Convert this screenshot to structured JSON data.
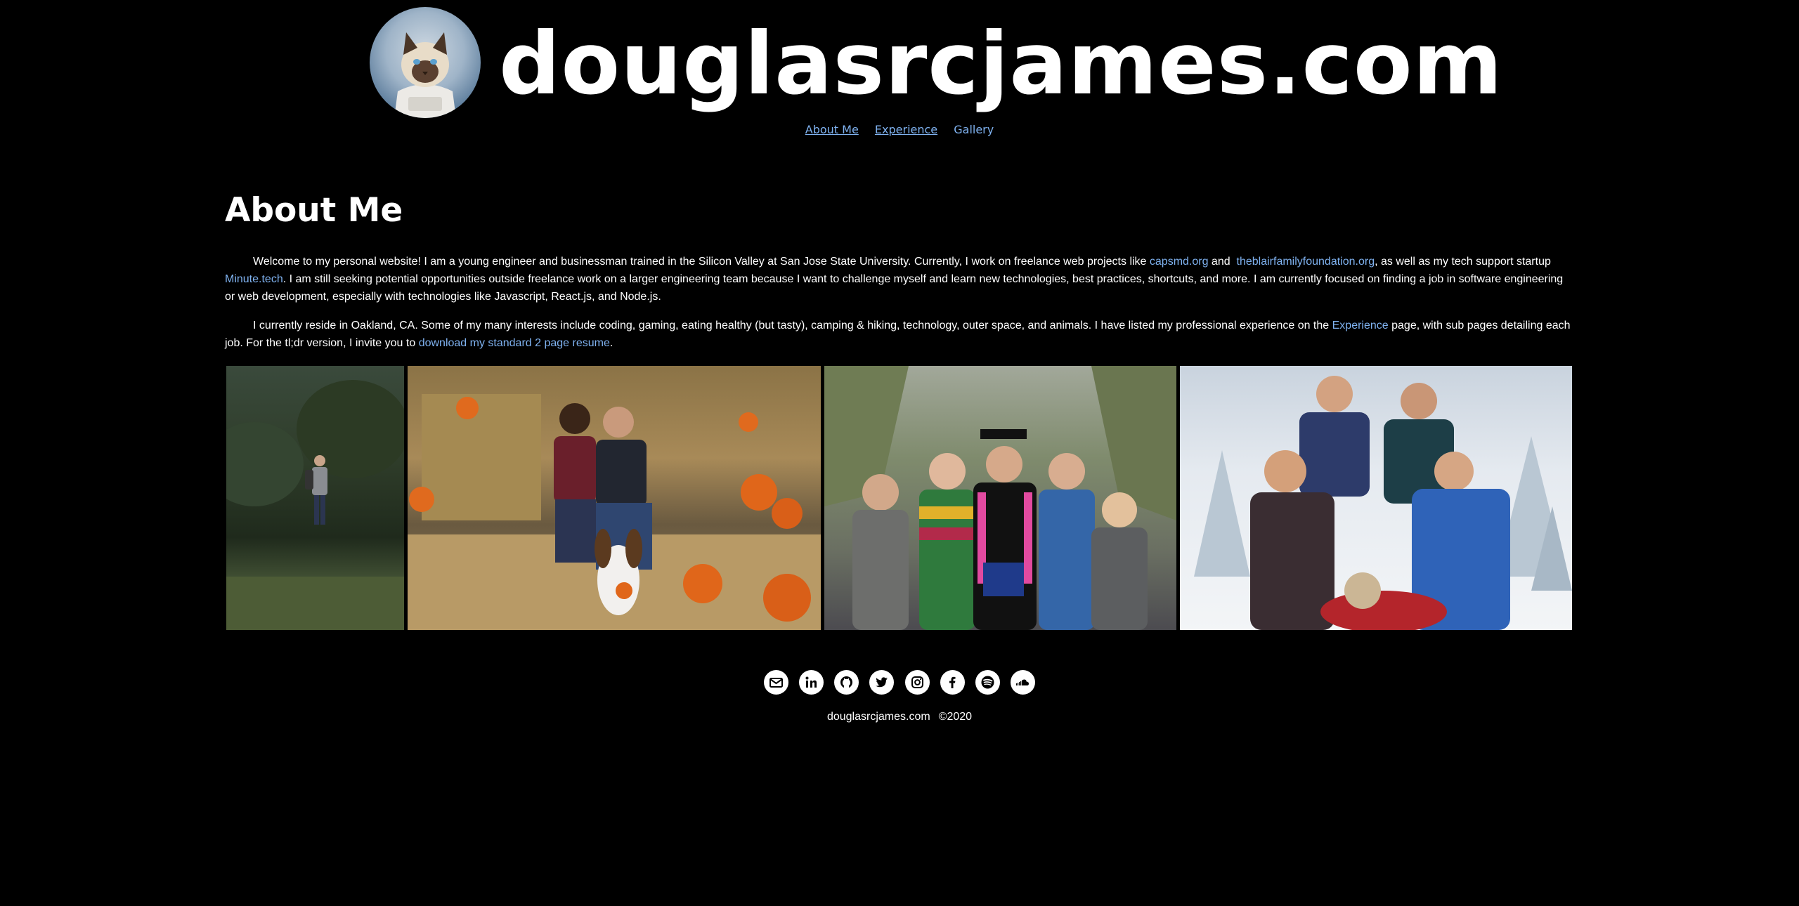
{
  "header": {
    "site_title": "douglasrcjames.com",
    "nav": [
      {
        "label": "About Me"
      },
      {
        "label": "Experience"
      },
      {
        "label": "Gallery"
      }
    ]
  },
  "about": {
    "heading": "About Me",
    "p1": {
      "t1": "Welcome to my personal website! I am a young engineer and businessman trained in the Silicon Valley at San Jose State University. Currently, I work on freelance web projects like ",
      "link1": "capsmd.org",
      "t2": " and ",
      "link2": "theblairfamilyfoundation.org",
      "t3": ", as well as my tech support startup ",
      "link3": "Minute.tech",
      "t4": ". I am still seeking potential opportunities outside freelance work on a larger engineering team because I want to challenge myself and learn new technologies, best practices, shortcuts, and more. I am currently focused on finding a job in software engineering or web development, especially with technologies like Javascript, React.js, and Node.js."
    },
    "p2": {
      "t1": "I currently reside in Oakland, CA. Some of my many interests include coding, gaming, eating healthy (but tasty), camping & hiking, technology, outer space, and animals. I have listed my professional experience on the ",
      "link1": "Experience",
      "t2": " page, with sub pages detailing each job. For the tl;dr version, I invite you to ",
      "link2": "download my standard 2 page resume",
      "t3": "."
    }
  },
  "social_icons": [
    "email-icon",
    "linkedin-icon",
    "github-icon",
    "twitter-icon",
    "instagram-icon",
    "facebook-icon",
    "spotify-icon",
    "soundcloud-icon"
  ],
  "footer": {
    "site": "douglasrcjames.com",
    "copyright": "©2020"
  },
  "colors": {
    "background": "#000000",
    "text": "#ffffff",
    "link": "#7fb2f0"
  }
}
